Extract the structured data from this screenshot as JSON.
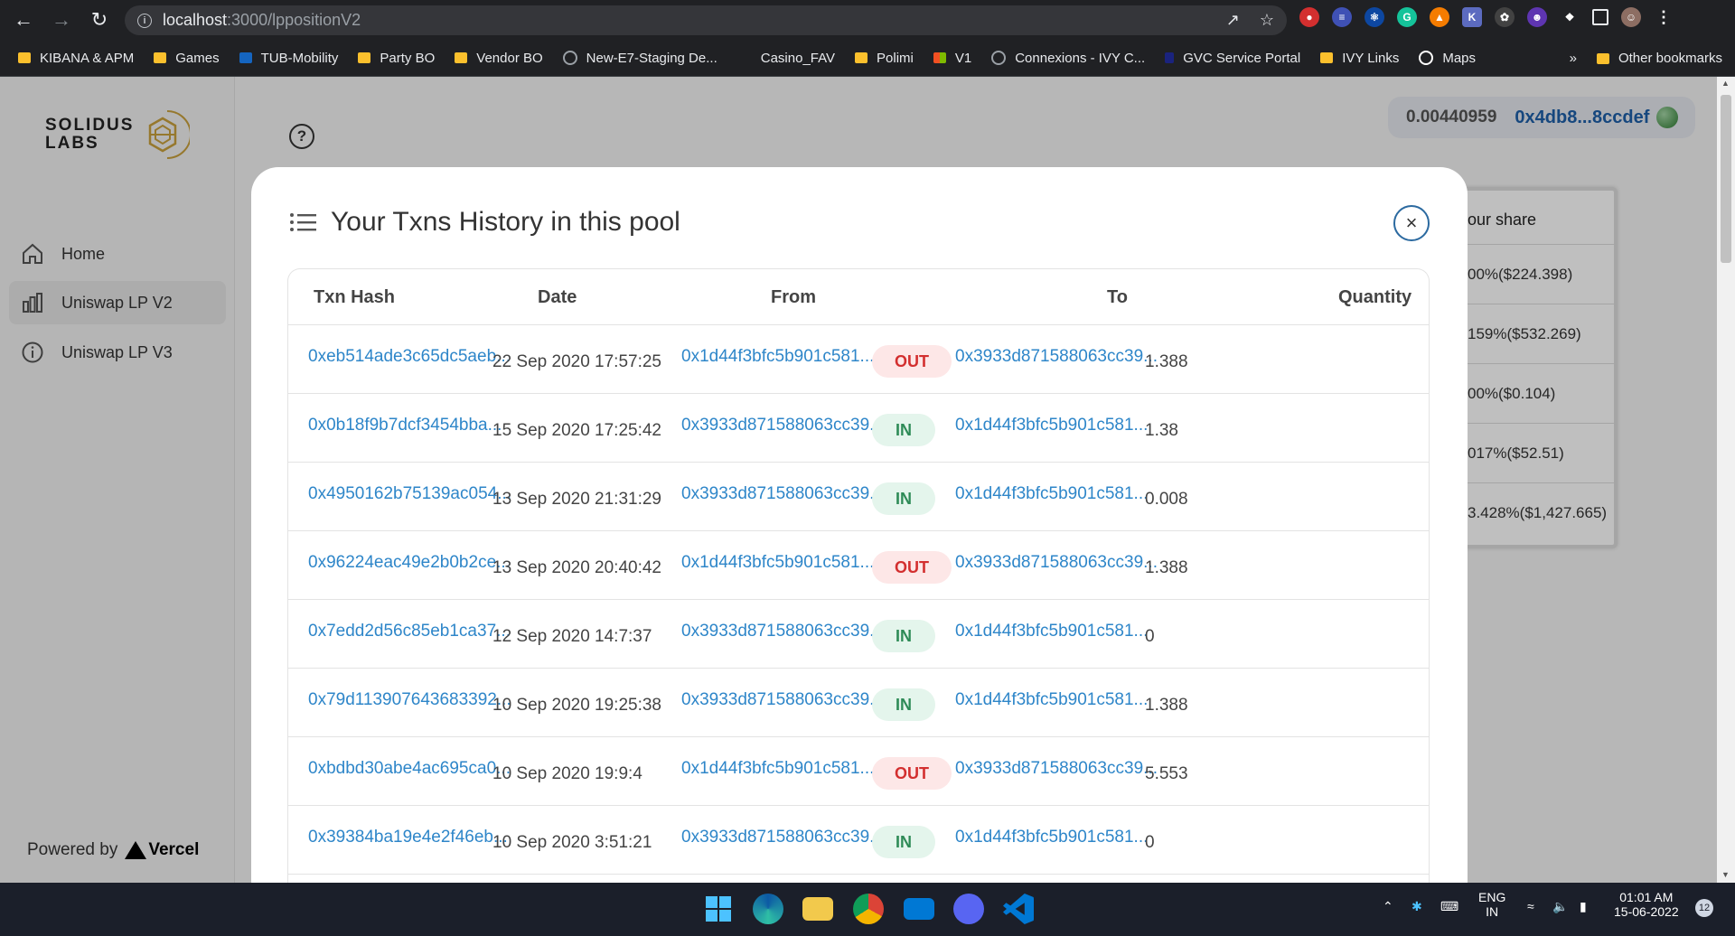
{
  "browser": {
    "url_host": "localhost",
    "url_rest": ":3000/lppositionV2",
    "bookmarks": [
      "KIBANA & APM",
      "Games",
      "TUB-Mobility",
      "Party BO",
      "Vendor BO",
      "New-E7-Staging De...",
      "Casino_FAV",
      "Polimi",
      "V1",
      "Connexions - IVY C...",
      "GVC Service Portal",
      "IVY Links",
      "Maps"
    ],
    "more": "»",
    "other_bookmarks": "Other bookmarks"
  },
  "sidebar": {
    "logo_line1": "SOLIDUS",
    "logo_line2": "LABS",
    "items": [
      {
        "label": "Home"
      },
      {
        "label": "Uniswap LP V2"
      },
      {
        "label": "Uniswap LP V3"
      }
    ],
    "powered_by": "Powered by",
    "vercel": "Vercel"
  },
  "wallet": {
    "balance": "0.00440959",
    "address": "0x4db8...8ccdef"
  },
  "share_card": {
    "header": "our share",
    "rows": [
      "00%($224.398)",
      "159%($532.269)",
      "00%($0.104)",
      "017%($52.51)",
      "3.428%($1,427.665)"
    ]
  },
  "modal": {
    "title": "Your Txns History in this pool",
    "close": "×",
    "columns": {
      "hash": "Txn Hash",
      "date": "Date",
      "from": "From",
      "to": "To",
      "quantity": "Quantity"
    },
    "rows": [
      {
        "hash": "0xeb514ade3c65dc5aeb...",
        "date": "22 Sep 2020 17:57:25",
        "from": "0x1d44f3bfc5b901c581...",
        "dir": "OUT",
        "to": "0x3933d871588063cc39...",
        "qty": "1.388"
      },
      {
        "hash": "0x0b18f9b7dcf3454bba...",
        "date": "15 Sep 2020 17:25:42",
        "from": "0x3933d871588063cc39...",
        "dir": "IN",
        "to": "0x1d44f3bfc5b901c581...",
        "qty": "1.38"
      },
      {
        "hash": "0x4950162b75139ac054...",
        "date": "13 Sep 2020 21:31:29",
        "from": "0x3933d871588063cc39...",
        "dir": "IN",
        "to": "0x1d44f3bfc5b901c581...",
        "qty": "0.008"
      },
      {
        "hash": "0x96224eac49e2b0b2ce...",
        "date": "13 Sep 2020 20:40:42",
        "from": "0x1d44f3bfc5b901c581...",
        "dir": "OUT",
        "to": "0x3933d871588063cc39...",
        "qty": "1.388"
      },
      {
        "hash": "0x7edd2d56c85eb1ca37...",
        "date": "12 Sep 2020 14:7:37",
        "from": "0x3933d871588063cc39...",
        "dir": "IN",
        "to": "0x1d44f3bfc5b901c581...",
        "qty": "0"
      },
      {
        "hash": "0x79d113907643683392...",
        "date": "10 Sep 2020 19:25:38",
        "from": "0x3933d871588063cc39...",
        "dir": "IN",
        "to": "0x1d44f3bfc5b901c581...",
        "qty": "1.388"
      },
      {
        "hash": "0xbdbd30abe4ac695ca0...",
        "date": "10 Sep 2020 19:9:4",
        "from": "0x1d44f3bfc5b901c581...",
        "dir": "OUT",
        "to": "0x3933d871588063cc39...",
        "qty": "5.553"
      },
      {
        "hash": "0x39384ba19e4e2f46eb...",
        "date": "10 Sep 2020 3:51:21",
        "from": "0x3933d871588063cc39...",
        "dir": "IN",
        "to": "0x1d44f3bfc5b901c581...",
        "qty": "0"
      }
    ]
  },
  "taskbar": {
    "lang1": "ENG",
    "lang2": "IN",
    "time": "01:01 AM",
    "date": "15-06-2022",
    "notif_count": "12"
  }
}
